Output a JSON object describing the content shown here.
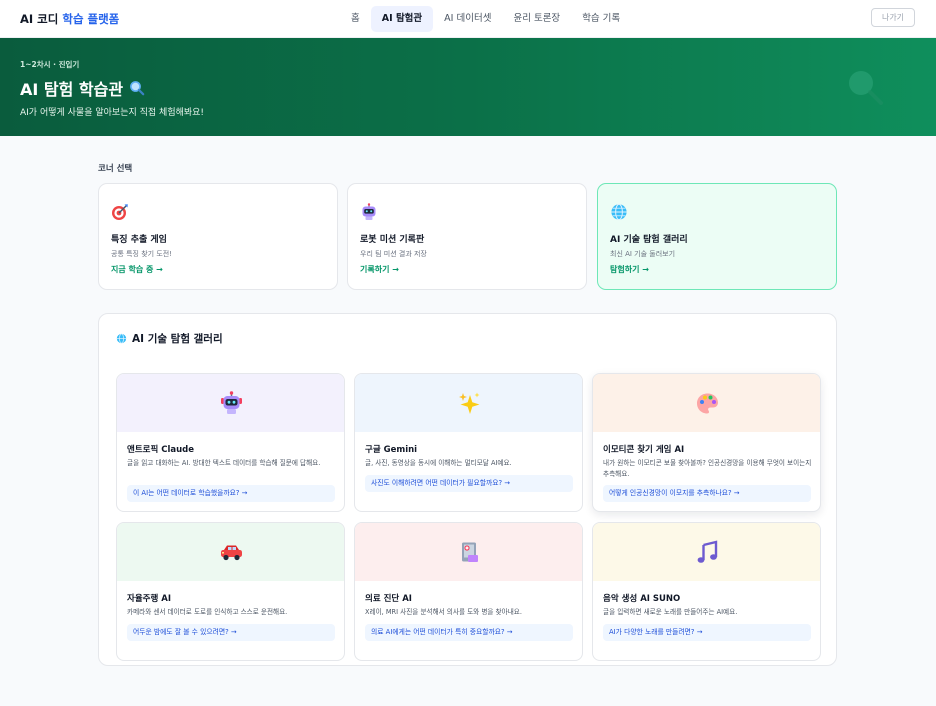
{
  "nav": {
    "brand_prefix": "AI 코디",
    "brand_accent": "학습 플랫폼",
    "links": [
      "홈",
      "AI 탐험관",
      "AI 데이터셋",
      "윤리 토론장",
      "학습 기록"
    ],
    "active": "AI 탐험관",
    "exit_label": "나가기"
  },
  "hero": {
    "eyebrow": "1~2차시 · 진입기",
    "title": "AI 탐험 학습관",
    "subtitle": "AI가 어떻게 사물을 알아보는지 직접 체험해봐요!"
  },
  "corner_label": "코너 선택",
  "corners": [
    {
      "title": "특징 추출 게임",
      "desc": "공통 특징 찾기 도전!",
      "link": "지금 학습 중 →",
      "icon": "target-icon"
    },
    {
      "title": "로봇 미션 기록판",
      "desc": "우리 팀 미션 결과 저장",
      "link": "기록하기 →",
      "icon": "robot-icon"
    },
    {
      "title": "AI 기술 탐험 갤러리",
      "desc": "최신 AI 기술 둘러보기",
      "link": "탐험하기 →",
      "icon": "globe-icon"
    }
  ],
  "gallery": {
    "title": "AI 기술 탐험 갤러리",
    "cards": [
      {
        "name": "앤트로픽 Claude",
        "desc": "글을 읽고 대화하는 AI. 방대한 텍스트 데이터를 학습해 질문에 답해요.",
        "question": "이 AI는 어떤 데이터로 학습했을까요? →",
        "icon": "robot-icon",
        "bg": "#f3f1fd"
      },
      {
        "name": "구글 Gemini",
        "desc": "글, 사진, 동영상을 동시에 이해하는 멀티모달 AI예요.",
        "question": "사진도 이해하려면 어떤 데이터가 필요할까요? →",
        "icon": "sparkles-icon",
        "bg": "#eef5fd"
      },
      {
        "name": "이모티콘 찾기 게임 AI",
        "desc": "내가 원하는 이모티콘 보물 찾아볼까? 인공신경망을 이용해 무엇이 보이는지 추측해요.",
        "question": "어떻게 인공신경망이 이모지를 추측하나요? →",
        "icon": "palette-icon",
        "bg": "#fdf1e8"
      },
      {
        "name": "자율주행 AI",
        "desc": "카메라와 센서 데이터로 도로를 인식하고 스스로 운전해요.",
        "question": "어두운 밤에도 잘 볼 수 있으려면? →",
        "icon": "car-icon",
        "bg": "#edf9f1"
      },
      {
        "name": "의료 진단 AI",
        "desc": "X레이, MRI 사진을 분석해서 의사를 도와 병을 찾아내요.",
        "question": "의료 AI에게는 어떤 데이터가 특히 중요할까요? →",
        "icon": "medical-icon",
        "bg": "#fdeeee"
      },
      {
        "name": "음악 생성 AI SUNO",
        "desc": "글을 입력하면 새로운 노래를 만들어주는 AI예요.",
        "question": "AI가 다양한 노래를 만들려면? →",
        "icon": "music-note-icon",
        "bg": "#fdf9e8"
      }
    ]
  },
  "colors": {
    "accent_blue": "#2563eb",
    "hero_green": "#0b7048",
    "link_green": "#059669",
    "selected_bg": "#ecfdf5"
  }
}
